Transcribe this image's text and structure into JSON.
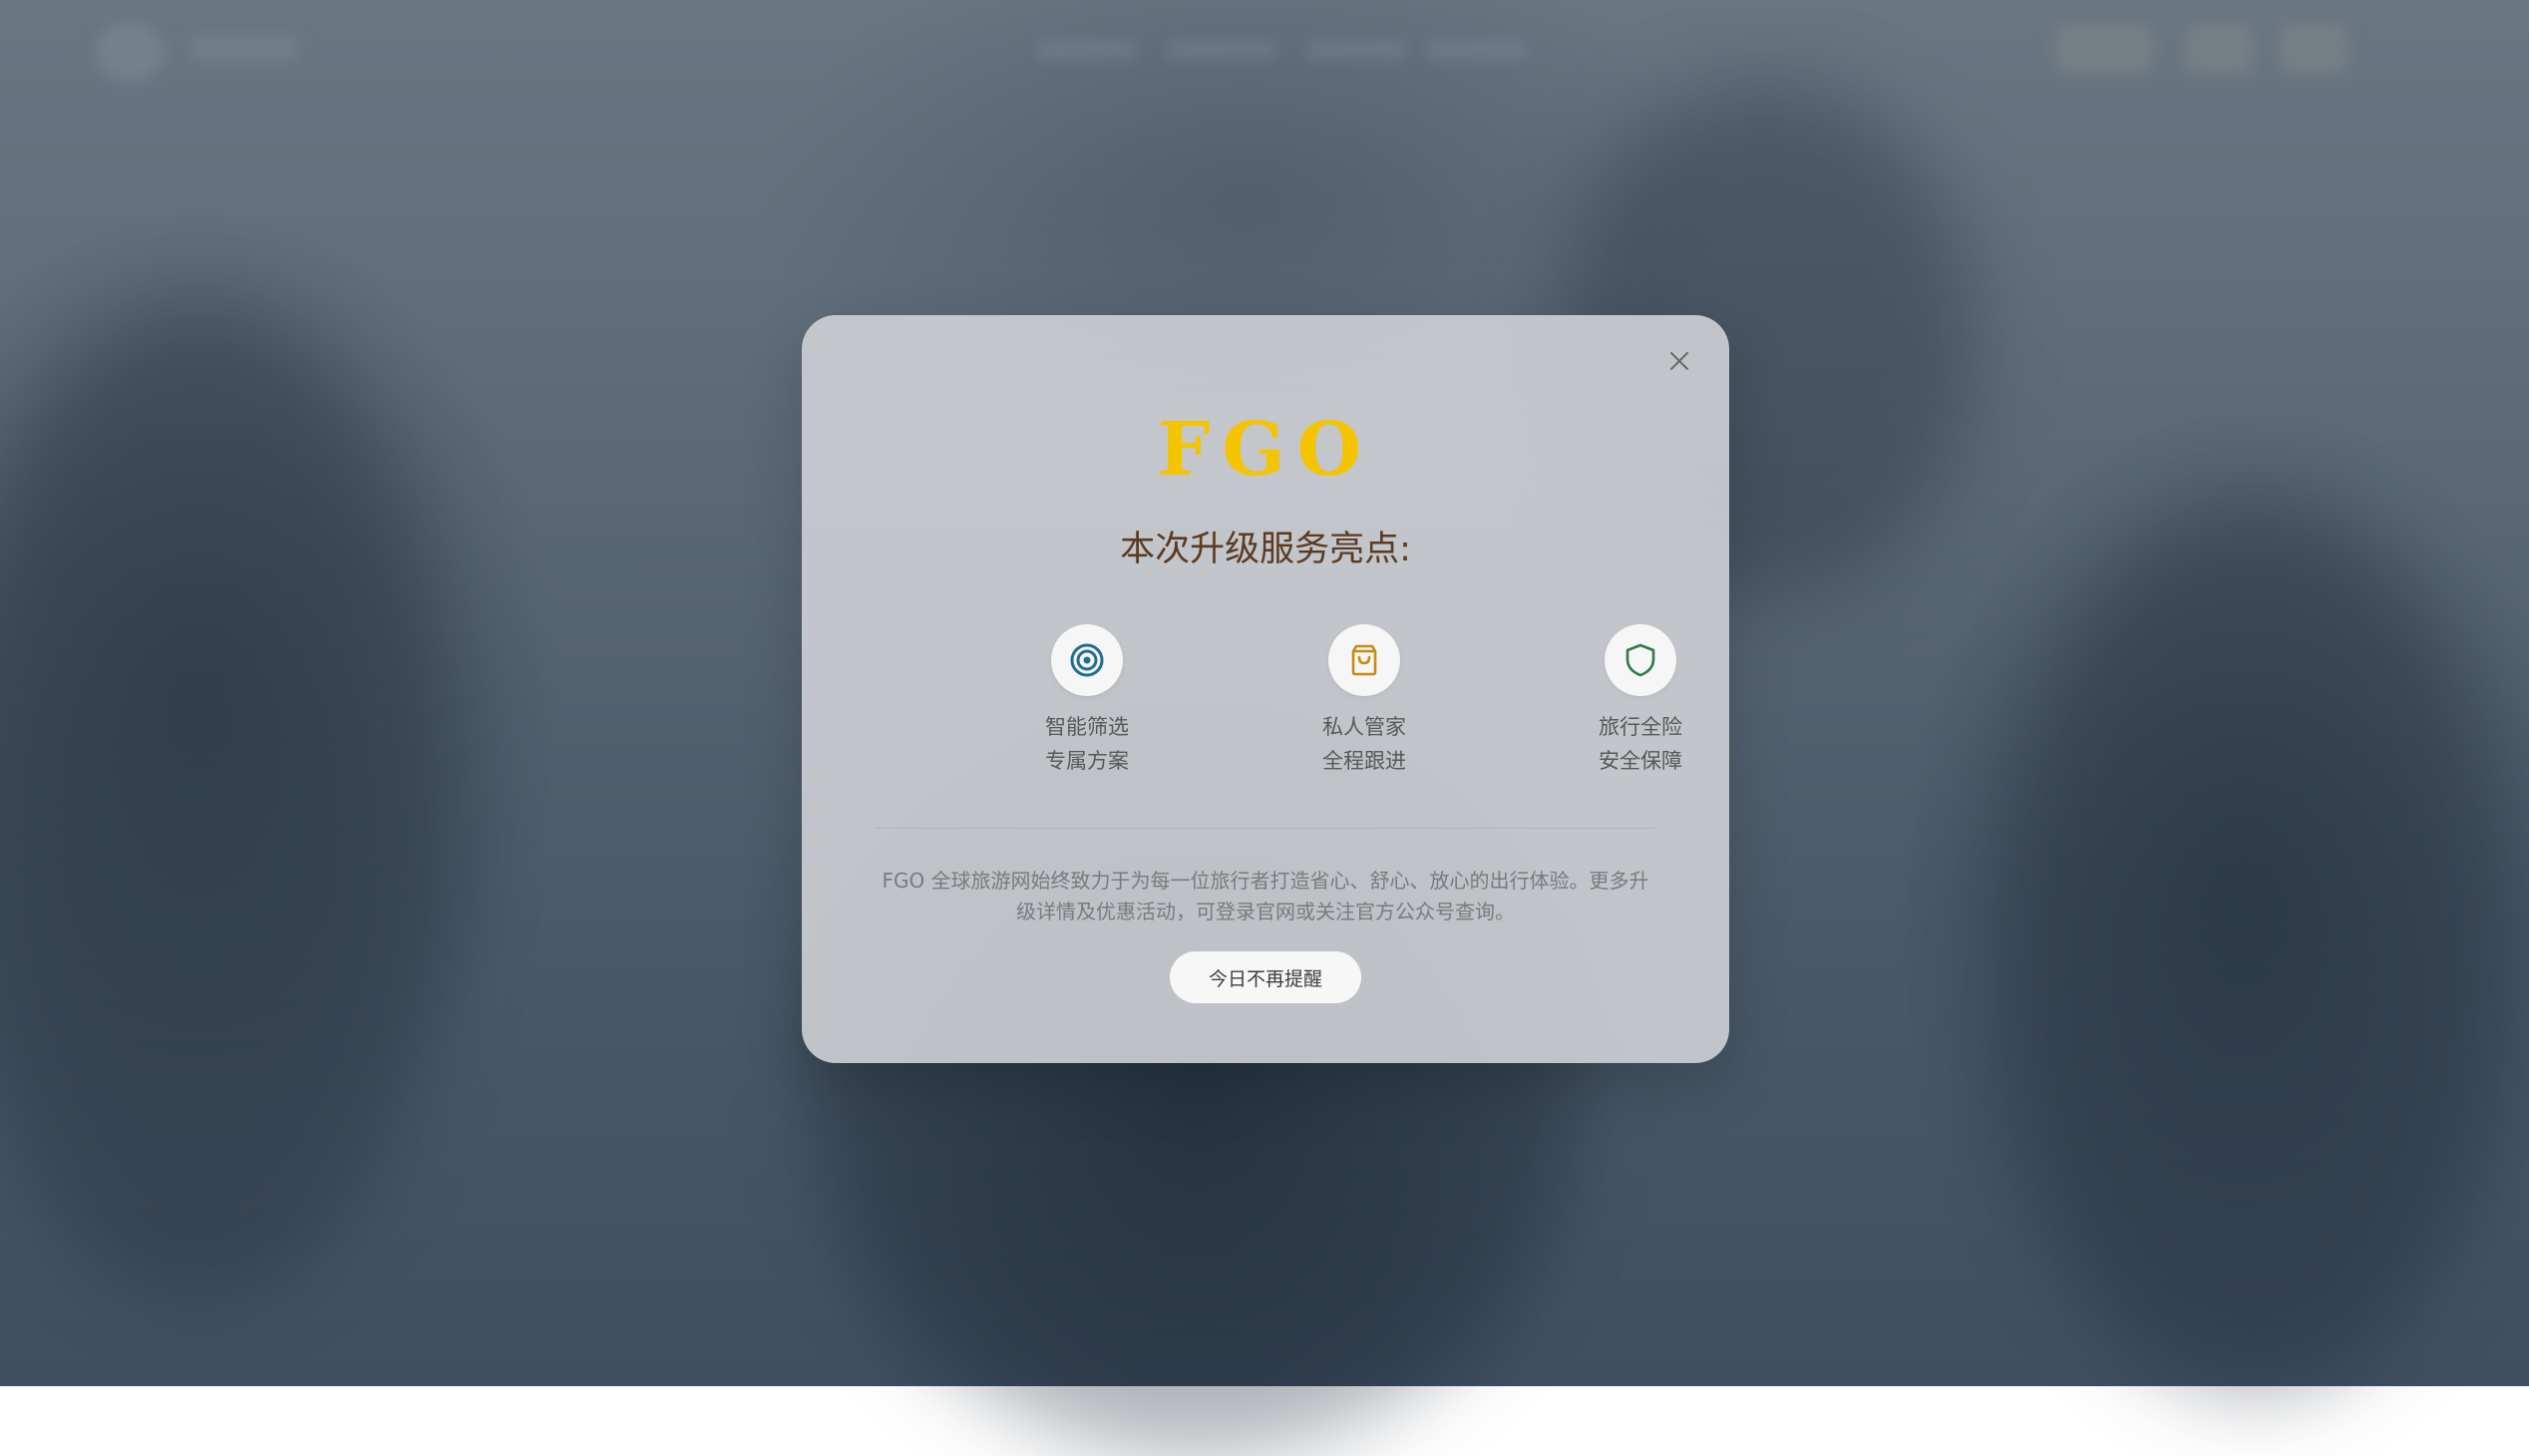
{
  "modal": {
    "logo_text": "FGO",
    "headline": "本次升级服务亮点:",
    "features": [
      {
        "icon": "target-icon",
        "line1": "智能筛选",
        "line2": "专属方案",
        "color": "#1f6d96"
      },
      {
        "icon": "shopping-bag-icon",
        "line1": "私人管家",
        "line2": "全程跟进",
        "color": "#c98a14"
      },
      {
        "icon": "shield-icon",
        "line1": "旅行全险",
        "line2": "安全保障",
        "color": "#2f7a4a"
      }
    ],
    "description": "FGO 全球旅游网始终致力于为每一位旅行者打造省心、舒心、放心的出行体验。更多升级详情及优惠活动，可登录官网或关注官方公众号查询。",
    "dismiss_label": "今日不再提醒",
    "close_icon": "close-icon"
  },
  "colors": {
    "logo": "#f5c400",
    "headline": "#5b3a22"
  }
}
